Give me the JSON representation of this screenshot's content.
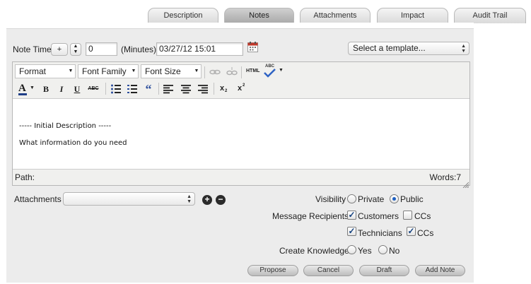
{
  "tabs": [
    {
      "label": "Description",
      "active": false
    },
    {
      "label": "Notes",
      "active": true
    },
    {
      "label": "Attachments",
      "active": false
    },
    {
      "label": "Impact",
      "active": false
    },
    {
      "label": "Audit Trail",
      "active": false
    }
  ],
  "note_time": {
    "label": "Note Time",
    "sign": "+",
    "minutes_value": "0",
    "minutes_label": "(Minutes)",
    "datetime_value": "03/27/12 15:01",
    "calendar_icon": "calendar-icon"
  },
  "template_select": {
    "value": "Select a template..."
  },
  "editor": {
    "format_select": "Format",
    "font_family_select": "Font Family",
    "font_size_select": "Font Size",
    "html_label": "HTML",
    "spell_label": "ABC",
    "strike_label": "ABC",
    "bold_label": "B",
    "italic_label": "I",
    "underline_label": "U",
    "font_color_label": "A",
    "subscript_label": "x",
    "superscript_label": "x",
    "quote_label": "“",
    "body_lines": [
      "----- Initial Description -----",
      "What information do you need"
    ],
    "path_label": "Path:",
    "words_label": "Words:7"
  },
  "attachments": {
    "label": "Attachments",
    "value": "",
    "add_icon": "plus-circle-icon",
    "remove_icon": "minus-circle-icon"
  },
  "visibility": {
    "label": "Visibility",
    "options": [
      {
        "label": "Private",
        "selected": false
      },
      {
        "label": "Public",
        "selected": true
      }
    ]
  },
  "message_recipients": {
    "label": "Message Recipients",
    "options": [
      {
        "label": "Customers",
        "checked": true
      },
      {
        "label": "CCs",
        "checked": false
      },
      {
        "label": "Technicians",
        "checked": true
      },
      {
        "label": "CCs",
        "checked": true
      }
    ]
  },
  "create_knowledge": {
    "label": "Create Knowledge",
    "options": [
      {
        "label": "Yes",
        "selected": false
      },
      {
        "label": "No",
        "selected": false
      }
    ]
  },
  "actions": {
    "propose": "Propose",
    "cancel": "Cancel",
    "draft": "Draft",
    "add_note": "Add Note"
  },
  "colors": {
    "panel_bg": "#ececec",
    "accent_blue": "#1d5fc2",
    "calendar_red": "#c0392b"
  }
}
